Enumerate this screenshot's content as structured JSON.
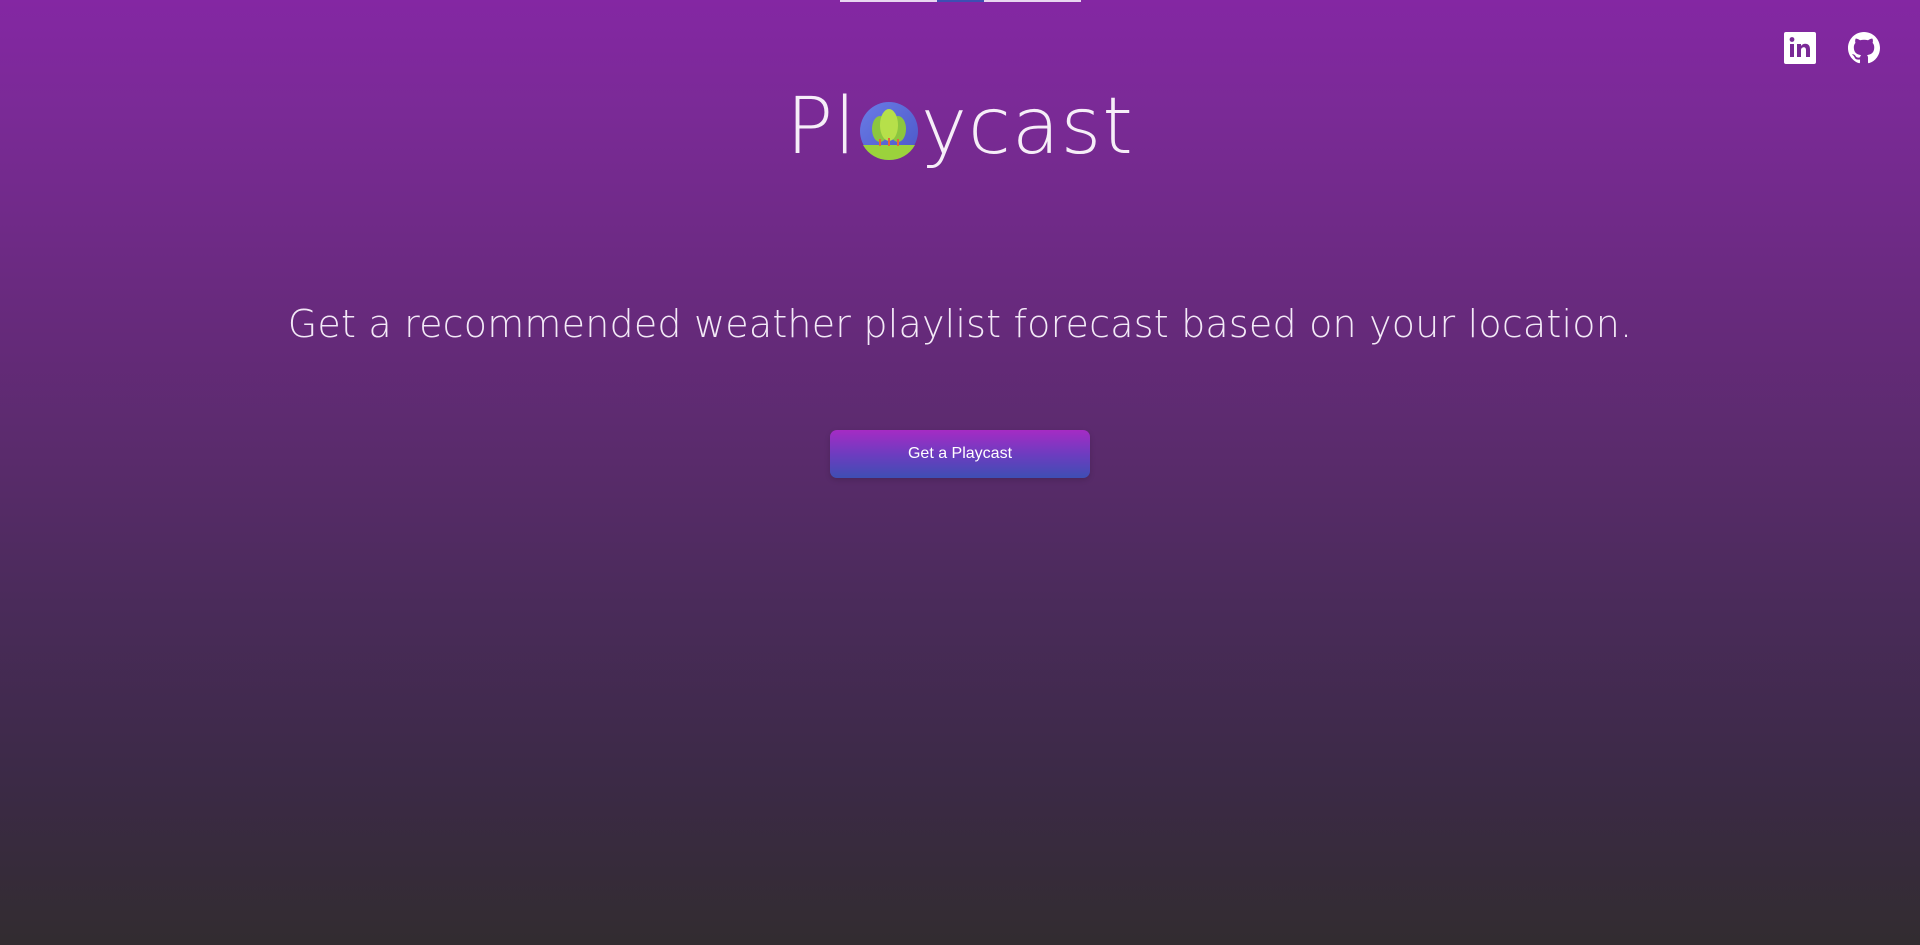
{
  "brand": {
    "name_before": "Pl",
    "name_after": "ycast",
    "logo_icon": "tree-sun-logo-icon"
  },
  "social": {
    "linkedin_icon": "linkedin-icon",
    "github_icon": "github-icon"
  },
  "tagline": "Get a recommended weather playlist forecast based on your location.",
  "cta": {
    "label": "Get a Playcast"
  },
  "colors": {
    "background_top": "#8427a3",
    "background_bottom": "#322c30",
    "button_top": "#a52bc4",
    "button_bottom": "#3e4eb3",
    "text": "#f3e9f7",
    "top_tab_light": "#e9d6f1",
    "top_tab_accent": "#3e4eb3"
  }
}
